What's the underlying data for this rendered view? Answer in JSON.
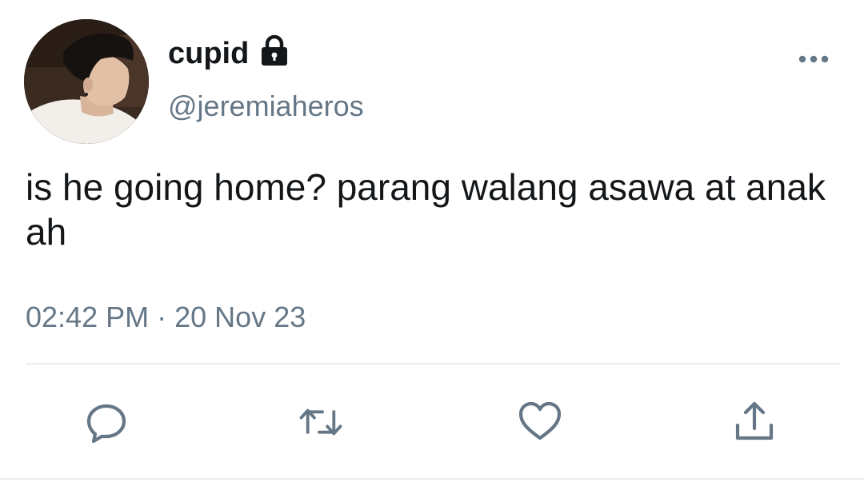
{
  "tweet": {
    "display_name": "cupid",
    "handle": "@jeremiaheros",
    "text": "is he going home? parang walang asawa at anak ah",
    "time": "02:42 PM",
    "separator": "·",
    "date": "20 Nov 23",
    "protected": true
  },
  "icons": {
    "lock": "lock-icon",
    "more": "more-icon",
    "reply": "reply-icon",
    "retweet": "retweet-icon",
    "like": "like-icon",
    "share": "share-icon"
  },
  "colors": {
    "text_primary": "#14171a",
    "text_secondary": "#657786",
    "icon": "#657786",
    "divider": "#e6ecf0",
    "background": "#ffffff"
  }
}
